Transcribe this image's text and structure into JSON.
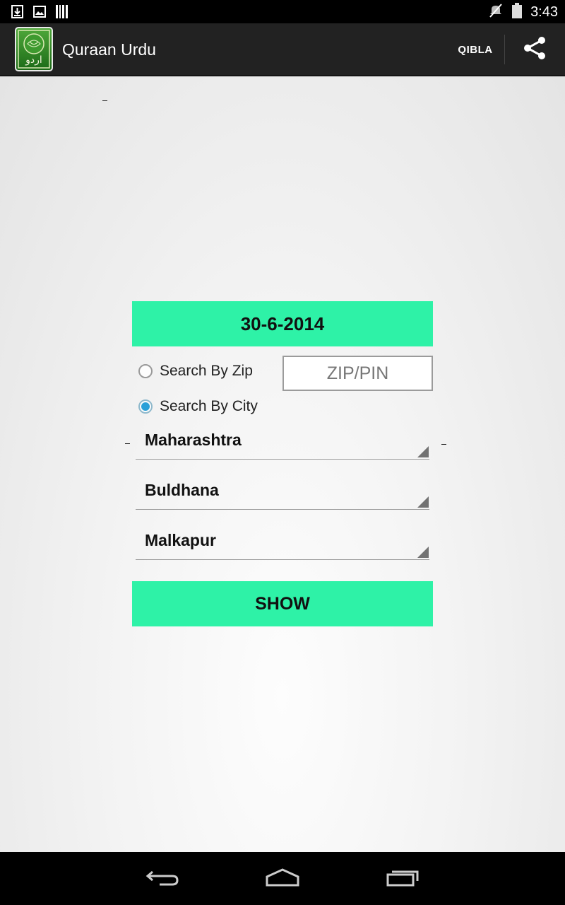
{
  "status_bar": {
    "time": "3:43",
    "icons": [
      "download-icon",
      "image-icon",
      "barcode-icon",
      "mute-icon",
      "battery-icon"
    ]
  },
  "action_bar": {
    "title": "Quraan Urdu",
    "app_icon": "quran-urdu-app-icon",
    "app_icon_text": "اردو",
    "qibla_label": "QIBLA",
    "share_icon": "share-icon"
  },
  "form": {
    "date_label": "30-6-2014",
    "radio_zip_label": "Search By Zip",
    "radio_city_label": "Search By City",
    "selected_radio": "city",
    "zip_placeholder": "ZIP/PIN",
    "zip_value": "",
    "state_value": "Maharashtra",
    "district_value": "Buldhana",
    "city_value": "Malkapur",
    "show_label": "SHOW"
  },
  "colors": {
    "accent_button": "#2ef2a7",
    "action_bar": "#222222",
    "radio_checked": "#2aa0d8"
  },
  "nav_bar": {
    "icons": [
      "back-icon",
      "home-icon",
      "recents-icon"
    ]
  }
}
